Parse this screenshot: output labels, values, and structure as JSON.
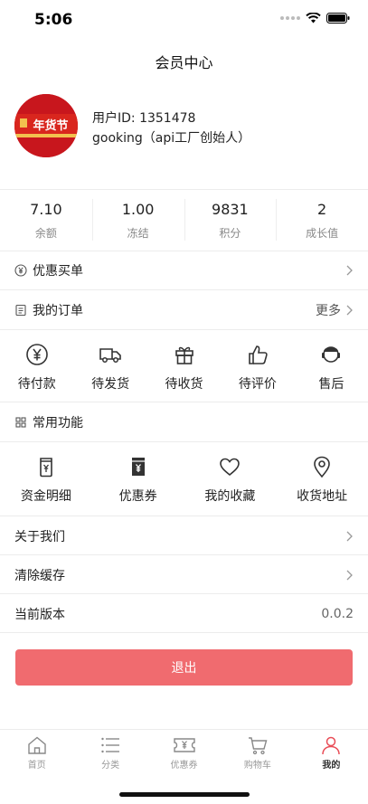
{
  "status_bar": {
    "time": "5:06"
  },
  "nav": {
    "title": "会员中心"
  },
  "profile": {
    "avatar_text": "年货节",
    "user_id": "用户ID: 1351478",
    "user_name": "gooking（api工厂创始人）"
  },
  "stats": [
    {
      "value": "7.10",
      "label": "余额"
    },
    {
      "value": "1.00",
      "label": "冻结"
    },
    {
      "value": "9831",
      "label": "积分"
    },
    {
      "value": "2",
      "label": "成长值"
    }
  ],
  "coupon_buy": {
    "label": "优惠买单"
  },
  "orders": {
    "label": "我的订单",
    "more": "更多"
  },
  "order_status": [
    {
      "label": "待付款",
      "icon": "yen-circle-icon"
    },
    {
      "label": "待发货",
      "icon": "truck-icon"
    },
    {
      "label": "待收货",
      "icon": "gift-icon"
    },
    {
      "label": "待评价",
      "icon": "thumb-up-icon"
    },
    {
      "label": "售后",
      "icon": "customer-service-icon"
    }
  ],
  "common": {
    "label": "常用功能"
  },
  "functions": [
    {
      "label": "资金明细",
      "icon": "wallet-icon"
    },
    {
      "label": "优惠券",
      "icon": "coupon-icon"
    },
    {
      "label": "我的收藏",
      "icon": "heart-icon"
    },
    {
      "label": "收货地址",
      "icon": "location-icon"
    }
  ],
  "menu": {
    "about": "关于我们",
    "clear_cache": "清除缓存",
    "version_label": "当前版本",
    "version_value": "0.0.2"
  },
  "logout": {
    "label": "退出"
  },
  "tabbar": [
    {
      "label": "首页",
      "icon": "home-icon"
    },
    {
      "label": "分类",
      "icon": "list-icon"
    },
    {
      "label": "优惠券",
      "icon": "ticket-icon"
    },
    {
      "label": "购物车",
      "icon": "cart-icon"
    },
    {
      "label": "我的",
      "icon": "user-icon"
    }
  ],
  "colors": {
    "accent": "#f06b6f",
    "active_tab": "#e94d57",
    "avatar_bg": "#c8161d"
  }
}
